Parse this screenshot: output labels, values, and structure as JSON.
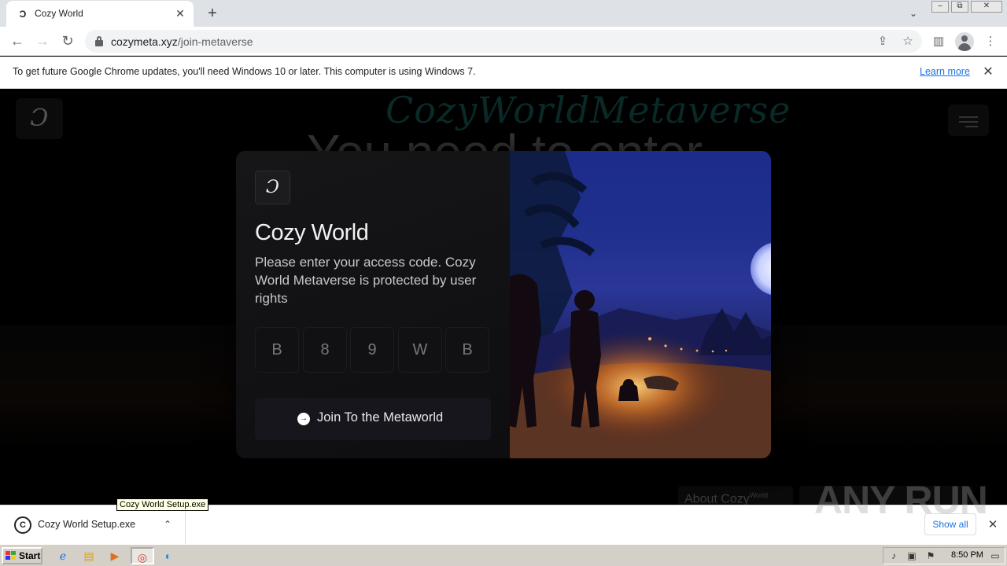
{
  "browser": {
    "tab": {
      "title": "Cozy World",
      "favicon": "cozy-logo-icon"
    },
    "window_controls": [
      "minimize",
      "restore",
      "close"
    ],
    "url_host": "cozymeta.xyz",
    "url_path": "/join-metaverse"
  },
  "infobar": {
    "message": "To get future Google Chrome updates, you'll need Windows 10 or later. This computer is using Windows 7.",
    "link": "Learn more"
  },
  "background_page": {
    "brand": "CozyWorldMetaverse",
    "headline": "You need to enter",
    "footer_link": "About Cozy",
    "footer_link_sup": "World"
  },
  "modal": {
    "title": "Cozy World",
    "description": "Please enter your access code. Cozy World Metaverse is protected by user rights",
    "code_chars": [
      "B",
      "8",
      "9",
      "W",
      "B"
    ],
    "join_label": "Join To the Metaworld"
  },
  "downloads": {
    "file_name": "Cozy World Setup.exe",
    "tooltip": "Cozy World Setup.exe",
    "show_all": "Show all"
  },
  "watermark": "ANY RUN",
  "taskbar": {
    "start_label": "Start",
    "clock": "8:50 PM"
  }
}
